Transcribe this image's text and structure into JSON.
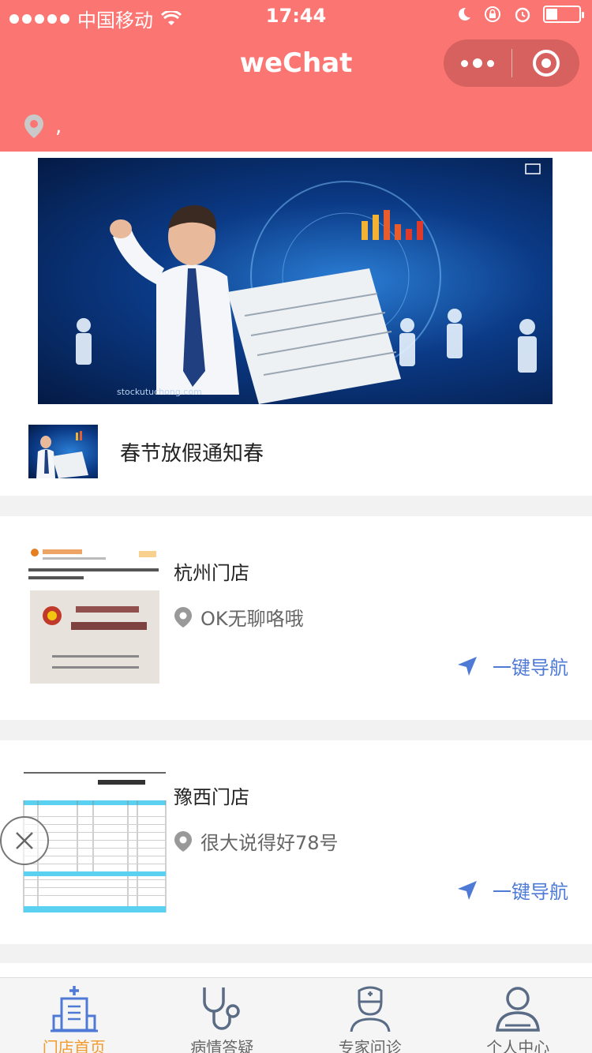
{
  "status_bar": {
    "carrier": "中国移动",
    "time": "17:44"
  },
  "nav": {
    "title": "weChat"
  },
  "location": {
    "text": ","
  },
  "news": {
    "title": "春节放假通知春"
  },
  "stores": [
    {
      "name": "杭州门店",
      "address": "OK无聊咯哦",
      "nav_label": "一键导航"
    },
    {
      "name": "豫西门店",
      "address": "很大说得好78号",
      "nav_label": "一键导航"
    }
  ],
  "tabs": [
    {
      "label": "门店首页",
      "icon": "hospital-icon",
      "active": true
    },
    {
      "label": "病情答疑",
      "icon": "stethoscope-icon",
      "active": false
    },
    {
      "label": "专家问诊",
      "icon": "doctor-icon",
      "active": false
    },
    {
      "label": "个人中心",
      "icon": "user-icon",
      "active": false
    }
  ],
  "colors": {
    "header": "#fb7572",
    "accent_blue": "#4e7ad6",
    "tab_active": "#f39a2a"
  }
}
